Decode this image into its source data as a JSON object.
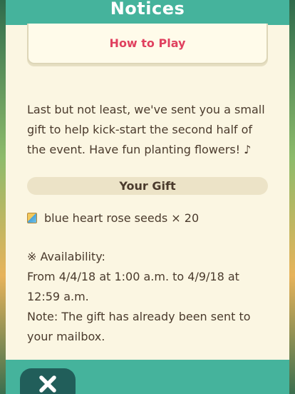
{
  "header": {
    "title": "Notices"
  },
  "how_to_play": {
    "label": "How to Play"
  },
  "message": {
    "lines": [
      "Last but not least, we've sent you a small",
      "gift to help kick-start the second half of",
      "the event. Have fun planting flowers! ♪"
    ]
  },
  "gift": {
    "title": "Your Gift",
    "item_icon": "seed-packet-icon",
    "item_text": "blue heart rose seeds × 20"
  },
  "availability": {
    "lines": [
      "※ Availability:",
      "From 4/4/18 at 1:00 a.m. to 4/9/18 at",
      "12:59 a.m.",
      "Note: The gift has already been sent to",
      "your mailbox."
    ]
  },
  "footer": {
    "close_icon": "close-icon"
  },
  "colors": {
    "header": "#45b39c",
    "panel": "#fbf6e2",
    "accent": "#e0415f",
    "close_button": "#215e5a"
  }
}
